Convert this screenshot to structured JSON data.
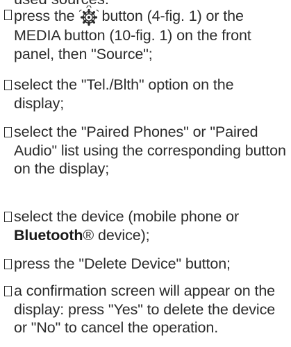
{
  "header_fragment": "used sources:",
  "steps": [
    {
      "before_icon": "press the",
      "icon": "settings-gear-icon",
      "after_icon": "button (4-fig. 1) or the MEDIA button (10-fig. 1) on the front panel, then \"Source\";"
    },
    {
      "text": "select the \"Tel./Blth\" option on the display;"
    },
    {
      "text": "select the \"Paired Phones\" or \"Paired Audio\" list using the corresponding button on the display;"
    },
    {
      "before_bold": "select the device (mobile phone or",
      "bold": "Bluetooth",
      "after_bold": "® device);"
    },
    {
      "text": "press the \"Delete Device\" button;"
    },
    {
      "text": "a confirmation screen will appear on the display: press \"Yes\" to delete the device or \"No\" to cancel the operation."
    }
  ]
}
